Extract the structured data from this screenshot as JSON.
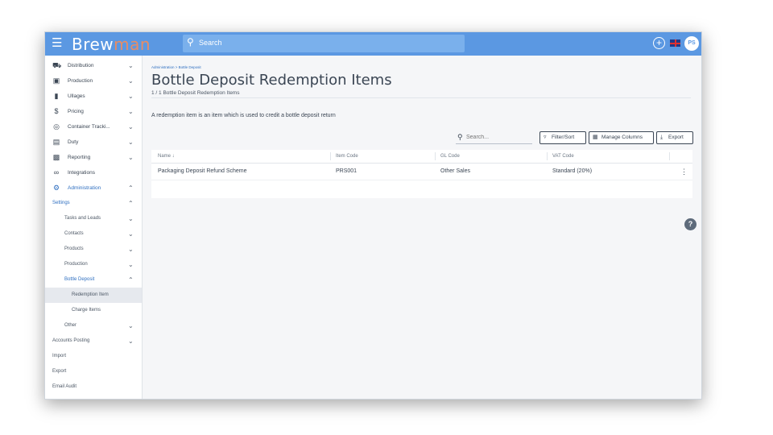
{
  "app": {
    "logo_main": "Brew",
    "logo_accent": "man"
  },
  "topbar": {
    "search_placeholder": "Search",
    "avatar_initials": "PS"
  },
  "sidebar": {
    "items": [
      {
        "label": "Distribution",
        "icon": "truck-icon"
      },
      {
        "label": "Production",
        "icon": "production-icon"
      },
      {
        "label": "Ullages",
        "icon": "bottle-icon"
      },
      {
        "label": "Pricing",
        "icon": "dollar-icon"
      },
      {
        "label": "Container Tracki...",
        "icon": "target-icon"
      },
      {
        "label": "Duty",
        "icon": "receipt-icon"
      },
      {
        "label": "Reporting",
        "icon": "report-icon"
      },
      {
        "label": "Integrations",
        "icon": "link-icon"
      },
      {
        "label": "Administration",
        "icon": "gear-icon"
      }
    ],
    "admin_sub": {
      "settings": "Settings",
      "settings_children": [
        "Tasks and Leads",
        "Contacts",
        "Products",
        "Production",
        "Bottle Deposit"
      ],
      "bottle_deposit_children": [
        "Redemption Item",
        "Charge Items"
      ],
      "other": "Other",
      "accounts_posting": "Accounts Posting",
      "import": "Import",
      "export": "Export",
      "email_audit": "Email Audit"
    }
  },
  "main": {
    "breadcrumb": "Administration > Bottle Deposit",
    "title": "Bottle Deposit Redemption Items",
    "record_count": "1 / 1 Bottle Deposit Redemption Items",
    "description": "A redemption item is an item which is used to credit a bottle deposit return",
    "search_placeholder": "Search...",
    "buttons": {
      "filter": "Filter/Sort",
      "manage_columns": "Manage Columns",
      "export": "Export"
    },
    "table": {
      "columns": [
        "Name ↓",
        "Item Code",
        "GL Code",
        "VAT Code"
      ],
      "rows": [
        [
          "Packaging Deposit Refund Scheme",
          "PRS001",
          "Other Sales",
          "Standard (20%)"
        ]
      ]
    }
  },
  "colors": {
    "topbar": "#5b98e2",
    "accent": "#e98c63",
    "link": "#2f6fc0"
  }
}
